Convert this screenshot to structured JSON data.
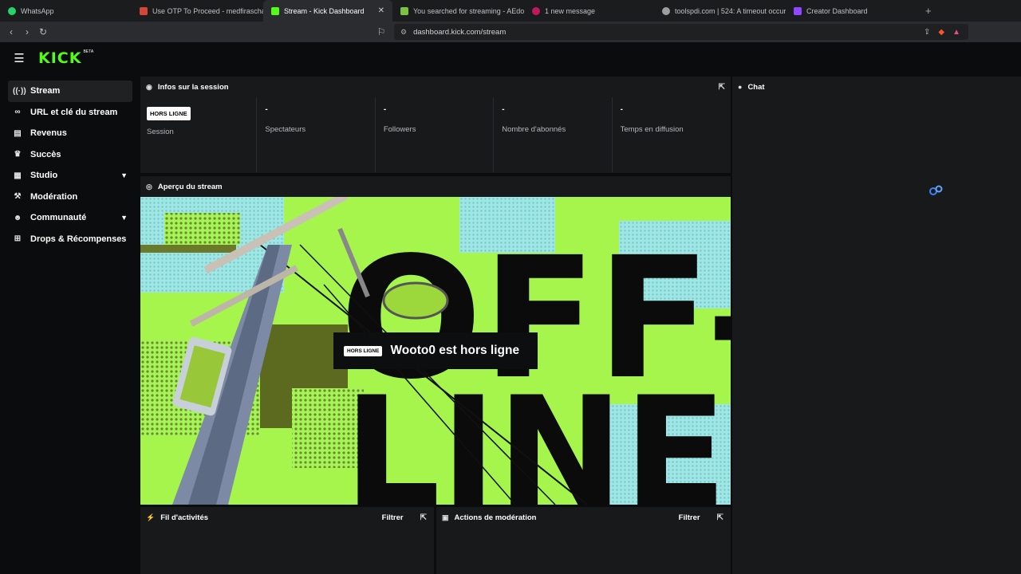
{
  "browser": {
    "tabs": [
      {
        "title": "WhatsApp",
        "favicon_color": "#25d366",
        "active": false
      },
      {
        "title": "Use OTP To Proceed - medfirascham…",
        "favicon_color": "#d44638",
        "active": false
      },
      {
        "title": "Stream - Kick Dashboard",
        "favicon_color": "#53fc18",
        "active": true
      },
      {
        "title": "You searched for streaming - AEdow…",
        "favicon_color": "#7cc242",
        "active": false
      },
      {
        "title": "1 new message",
        "favicon_color": "#c2185b",
        "active": false
      },
      {
        "title": "toolspdi.com | 524: A timeout occurre…",
        "favicon_color": "#9e9e9e",
        "active": false
      },
      {
        "title": "Creator Dashboard",
        "favicon_color": "#9146ff",
        "active": false
      }
    ],
    "url": "dashboard.kick.com/stream"
  },
  "app": {
    "logo_text": "KICK",
    "beta_label": "BETA",
    "accent_color": "#53fc18"
  },
  "sidebar": {
    "items": [
      {
        "label": "Stream",
        "icon": "broadcast-icon",
        "active": true
      },
      {
        "label": "URL et clé du stream",
        "icon": "link-icon"
      },
      {
        "label": "Revenus",
        "icon": "bar-chart-icon"
      },
      {
        "label": "Succès",
        "icon": "trophy-icon"
      },
      {
        "label": "Studio",
        "icon": "grid-icon",
        "expandable": true
      },
      {
        "label": "Modération",
        "icon": "gavel-icon"
      },
      {
        "label": "Communauté",
        "icon": "people-icon",
        "expandable": true
      },
      {
        "label": "Drops & Récompenses",
        "icon": "gift-icon"
      }
    ]
  },
  "session": {
    "title": "Infos sur la session",
    "status_badge": "HORS LIGNE",
    "session_label": "Session",
    "stats": [
      {
        "value": "-",
        "label": "Spectateurs"
      },
      {
        "value": "-",
        "label": "Followers"
      },
      {
        "value": "-",
        "label": "Nombre d'abonnés"
      },
      {
        "value": "-",
        "label": "Temps en diffusion"
      }
    ]
  },
  "preview": {
    "title": "Aperçu du stream",
    "badge": "HORS LIGNE",
    "message": "Wooto0 est hors ligne",
    "bg_word_1": "OFF-",
    "bg_word_2": "LINE"
  },
  "chat": {
    "title": "Chat"
  },
  "activity": {
    "title": "Fil d'activités",
    "filter_label": "Filtrer"
  },
  "moderation": {
    "title": "Actions de modération",
    "filter_label": "Filtrer"
  }
}
